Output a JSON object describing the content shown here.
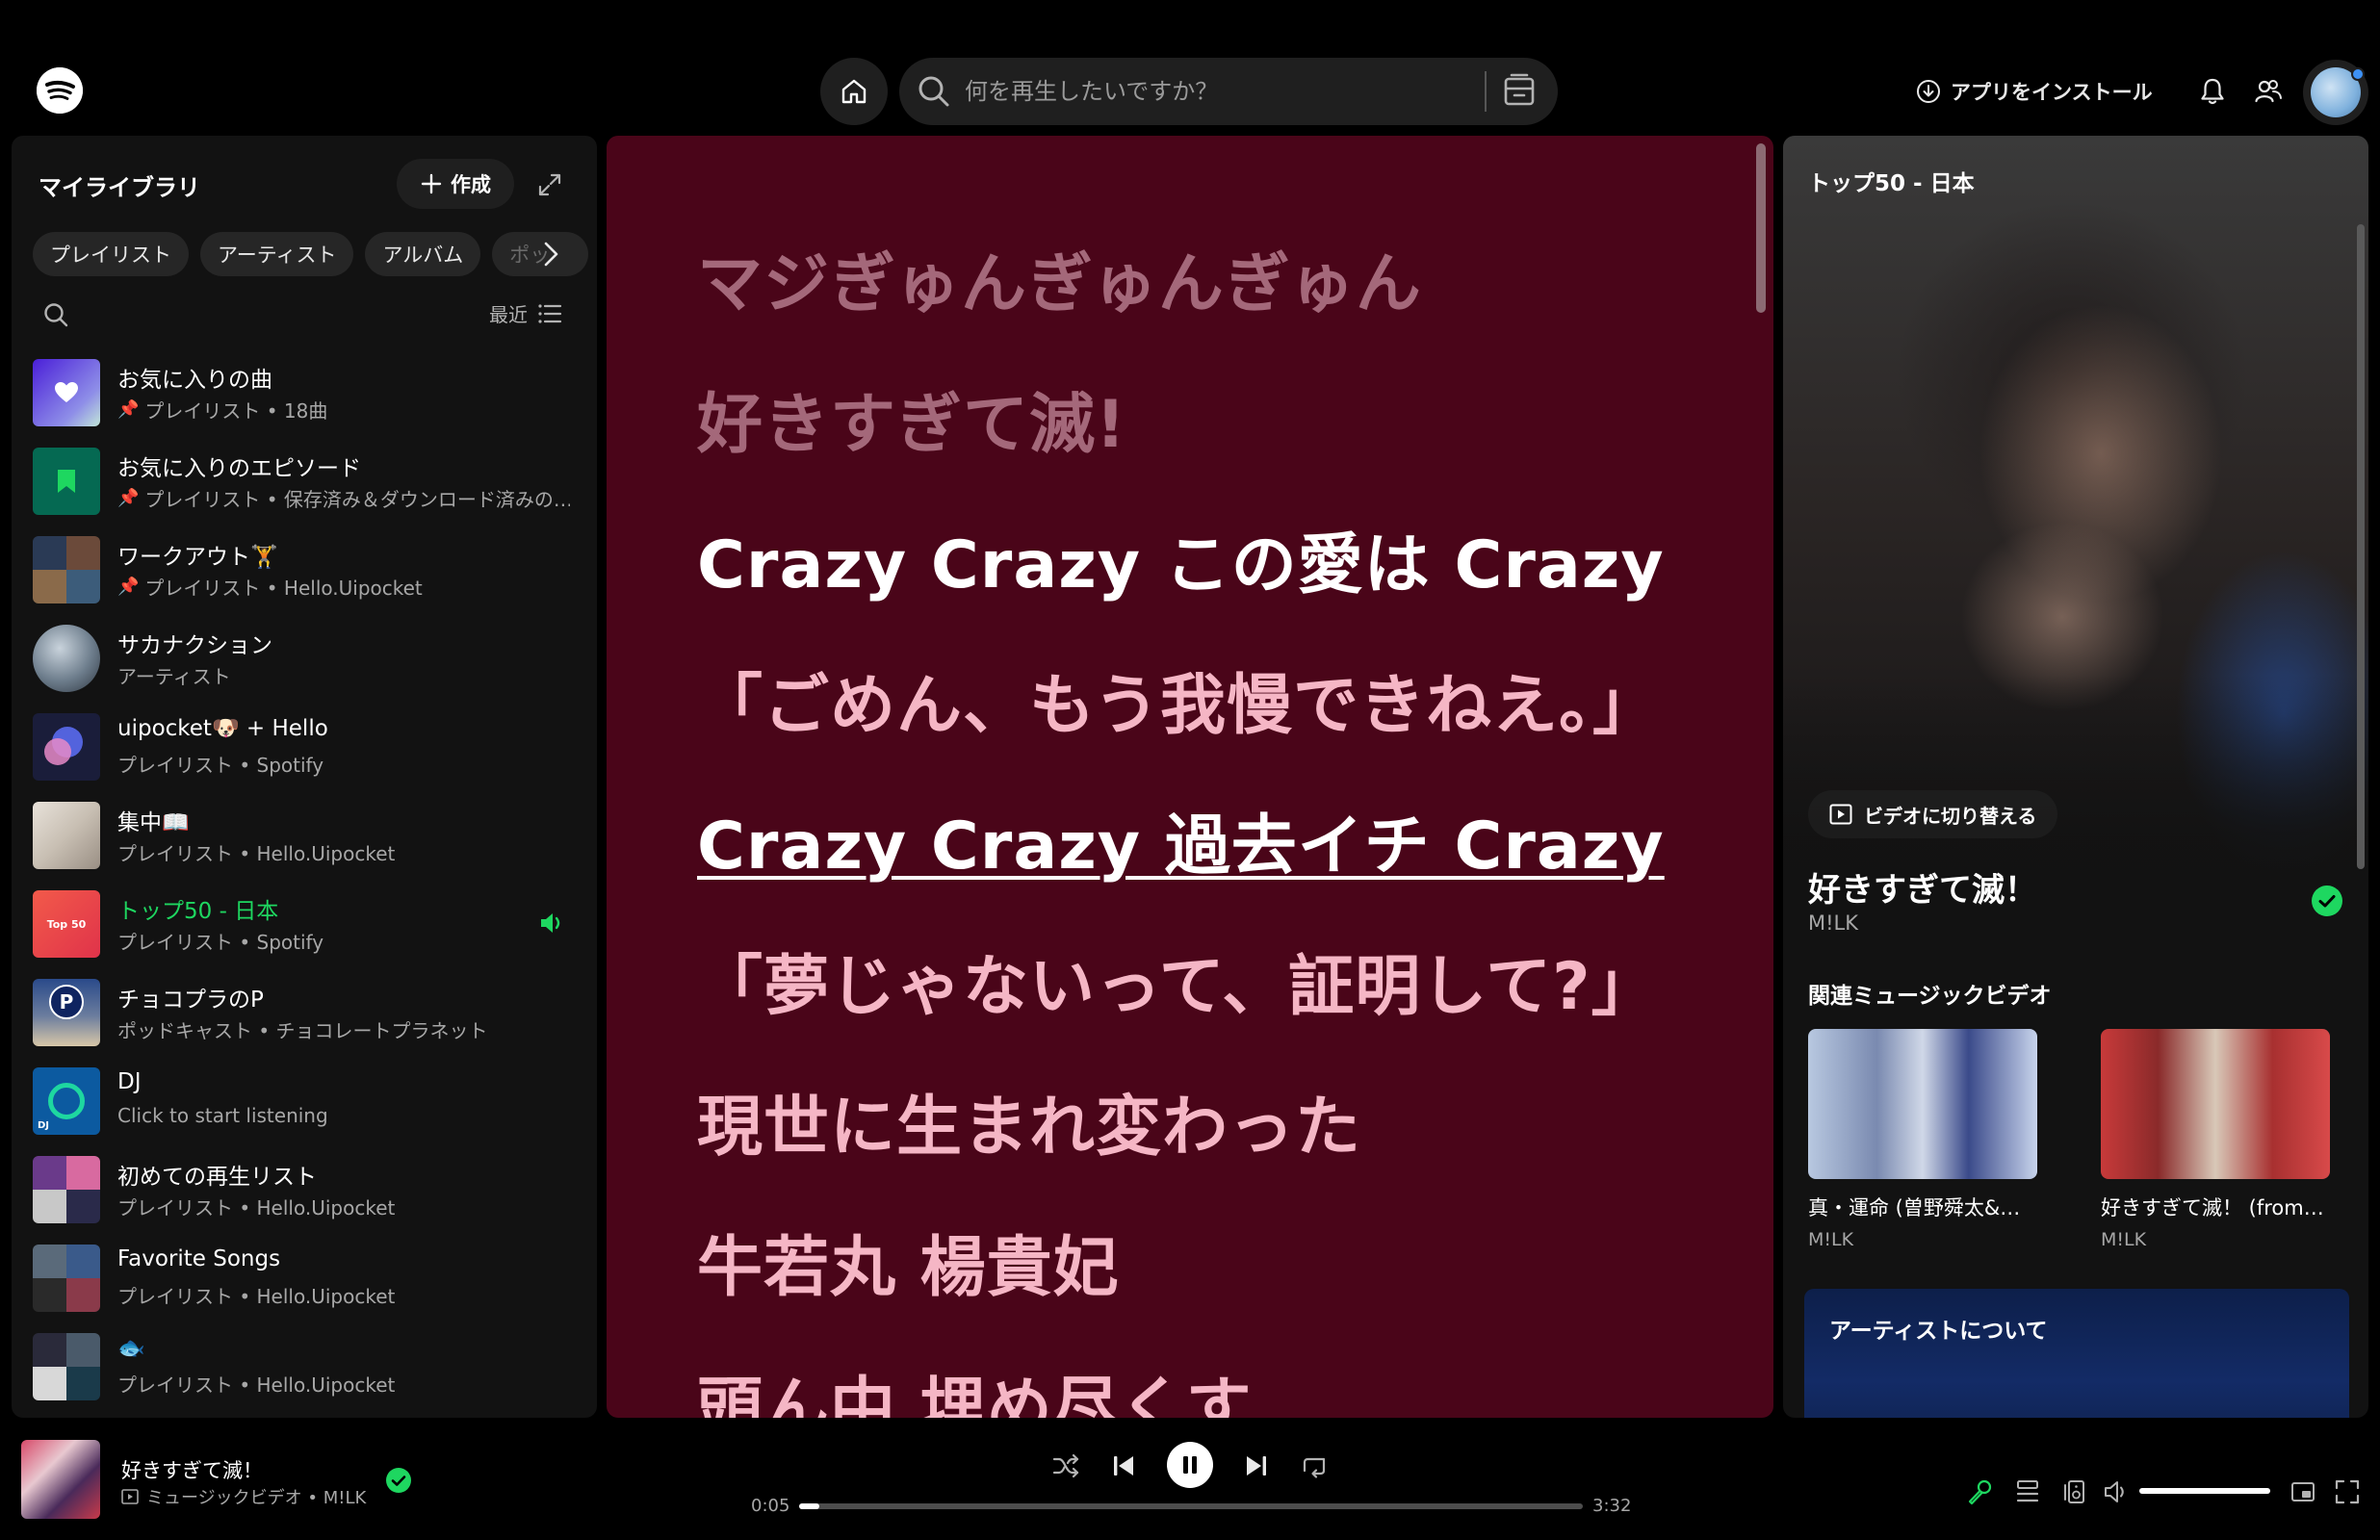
{
  "topbar": {
    "search_placeholder": "何を再生したいですか？",
    "install_label": "アプリをインストール"
  },
  "library": {
    "title": "マイライブラリ",
    "create_label": "作成",
    "chips": [
      "プレイリスト",
      "アーティスト",
      "アルバム",
      "ポッ"
    ],
    "sort_label": "最近",
    "items": [
      {
        "name": "お気に入りの曲",
        "sub": "プレイリスト • 18曲",
        "pinned": true
      },
      {
        "name": "お気に入りのエピソード",
        "sub": "プレイリスト • 保存済み＆ダウンロード済みの…",
        "pinned": true
      },
      {
        "name": "ワークアウト🏋",
        "sub": "プレイリスト • Hello.Uipocket",
        "pinned": true
      },
      {
        "name": "サカナクション",
        "sub": "アーティスト",
        "pinned": false
      },
      {
        "name": "uipocket🐶 + Hello",
        "sub": "プレイリスト • Spotify",
        "pinned": false
      },
      {
        "name": "集中📖",
        "sub": "プレイリスト • Hello.Uipocket",
        "pinned": false
      },
      {
        "name": "トップ50 - 日本",
        "sub": "プレイリスト • Spotify",
        "pinned": false,
        "active": true
      },
      {
        "name": "チョコプラのP",
        "sub": "ポッドキャスト • チョコレートプラネット",
        "pinned": false
      },
      {
        "name": "DJ",
        "sub": "Click to start listening",
        "pinned": false
      },
      {
        "name": "初めての再生リスト",
        "sub": "プレイリスト • Hello.Uipocket",
        "pinned": false
      },
      {
        "name": "Favorite Songs",
        "sub": "プレイリスト • Hello.Uipocket",
        "pinned": false
      },
      {
        "name": "🐟",
        "sub": "プレイリスト • Hello.Uipocket",
        "pinned": false
      }
    ],
    "thumb_labels": {
      "top50": "Top 50",
      "dj": "DJ"
    }
  },
  "lyrics": {
    "lines": [
      {
        "text": "マジぎゅんぎゅんぎゅん",
        "state": "past"
      },
      {
        "text": "好きすぎて滅!",
        "state": "past"
      },
      {
        "text": "Crazy Crazy この愛は Crazy",
        "state": "current"
      },
      {
        "text": "「ごめん、もう我慢できねえ。」",
        "state": "future"
      },
      {
        "text": "Crazy Crazy 過去イチ Crazy",
        "state": "current-underlined"
      },
      {
        "text": "「夢じゃないって、証明して?」",
        "state": "future"
      },
      {
        "text": "現世に生まれ変わった",
        "state": "future"
      },
      {
        "text": "牛若丸 楊貴妃",
        "state": "future"
      },
      {
        "text": "頭ん中 埋め尽くす",
        "state": "future"
      }
    ]
  },
  "now_playing_view": {
    "title": "トップ50 - 日本",
    "switch_video_label": "ビデオに切り替える",
    "track_name": "好きすぎて滅！",
    "artist": "M!LK",
    "related_title": "関連ミュージックビデオ",
    "related": [
      {
        "name": "真・運命 (曽野舜太&…",
        "artist": "M!LK"
      },
      {
        "name": "好きすぎて滅！ (from…",
        "artist": "M!LK"
      }
    ],
    "about_title": "アーティストについて"
  },
  "player": {
    "track_title": "好きすぎて滅！",
    "track_sub": "ミュージックビデオ • M!LK",
    "elapsed": "0:05",
    "duration": "3:32",
    "progress_fraction": 0.026,
    "volume_fraction": 1.0
  },
  "colors": {
    "accent": "#1ed760",
    "lyrics_bg": "#4a0519",
    "lyric_past": "#a4687a",
    "lyric_future": "#f5b6c5"
  }
}
